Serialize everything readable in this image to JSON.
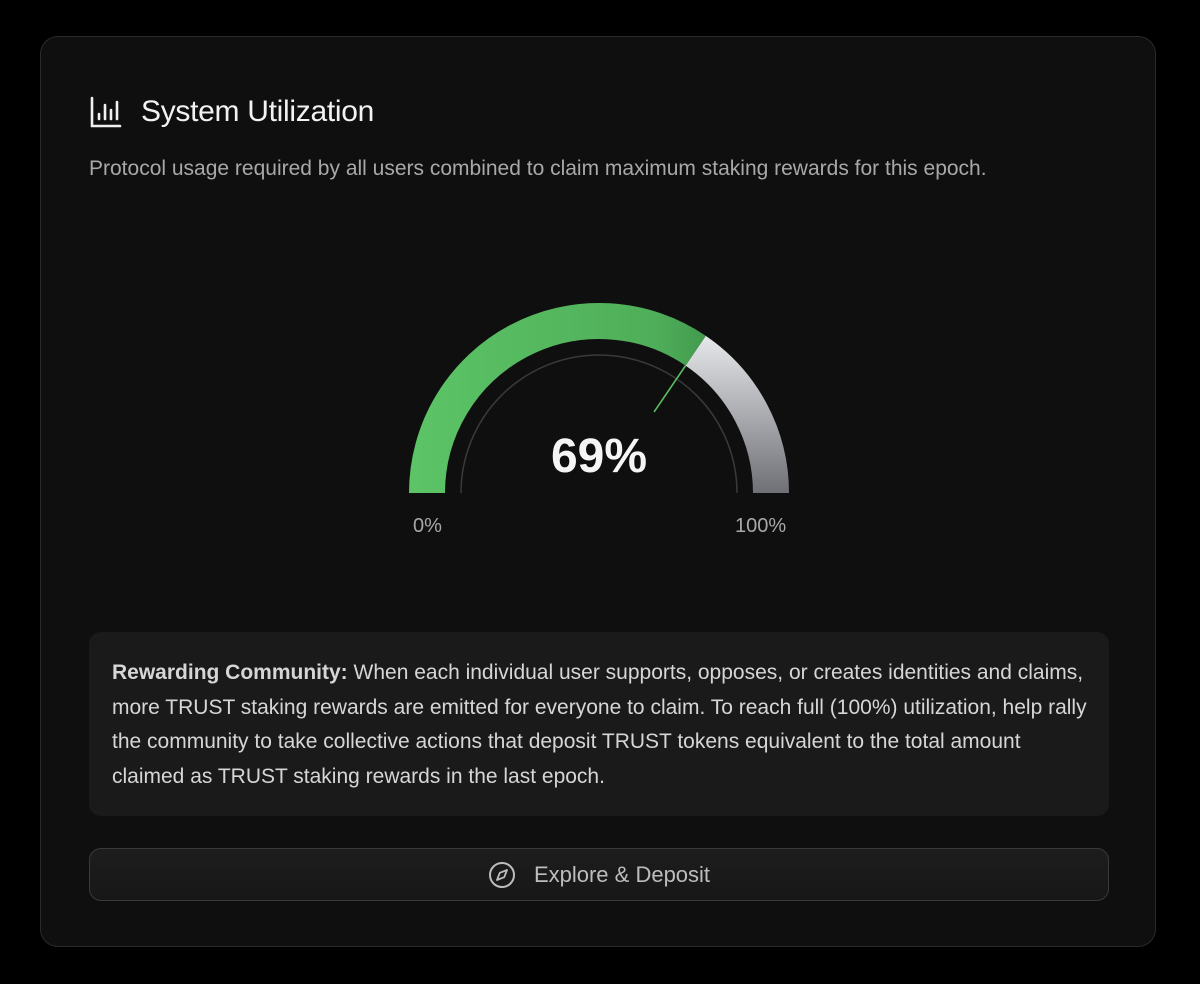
{
  "panel": {
    "title": "System Utilization",
    "title_icon": "bar-chart-icon",
    "subtitle": "Protocol usage required by all users combined to claim maximum staking rewards for this epoch."
  },
  "gauge": {
    "value": 69,
    "value_label": "69%",
    "min_label": "0%",
    "max_label": "100%",
    "fill_color": "#55b85f",
    "remaining_color": "#c8c9cc"
  },
  "info": {
    "heading": "Rewarding Community:",
    "body": " When each individual user supports, opposes, or creates identities and claims, more TRUST staking rewards are emitted for everyone to claim. To reach full (100%) utilization, help rally the community to take collective actions that deposit TRUST tokens equivalent to the total amount claimed as TRUST staking rewards in the last epoch."
  },
  "action": {
    "label": "Explore & Deposit",
    "icon": "compass-icon"
  }
}
